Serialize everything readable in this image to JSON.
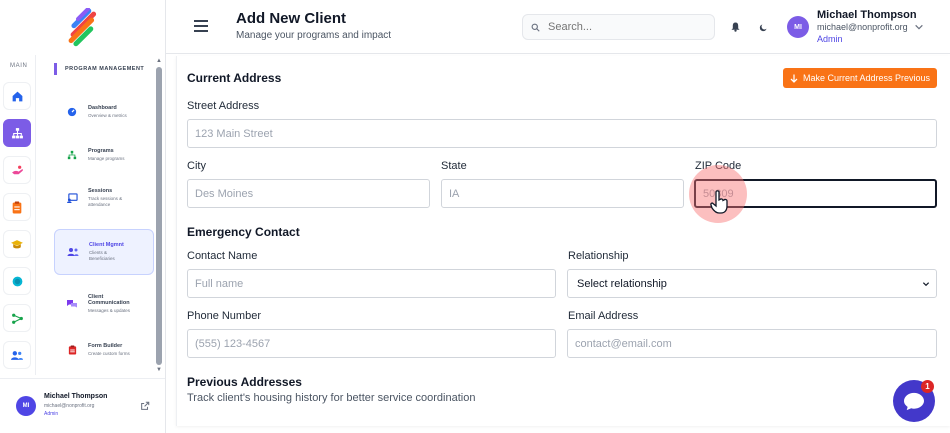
{
  "colors": {
    "accent": "#7c5ce6",
    "primary": "#4f46e5",
    "orange": "#f97316",
    "chat": "#4338ca",
    "badge": "#dc2626"
  },
  "rail": {
    "label": "MAIN",
    "items": [
      {
        "icon": "home-icon",
        "active": false
      },
      {
        "icon": "sitemap-icon",
        "active": true
      },
      {
        "icon": "hand-heart-icon",
        "active": false
      },
      {
        "icon": "clipboard-icon",
        "active": false
      },
      {
        "icon": "graduation-cap-icon",
        "active": false
      },
      {
        "icon": "globe-icon",
        "active": false
      },
      {
        "icon": "share-nodes-icon",
        "active": false
      },
      {
        "icon": "users-icon",
        "active": false
      }
    ]
  },
  "sidebar": {
    "section_title": "PROGRAM MANAGEMENT",
    "items": [
      {
        "title": "Dashboard",
        "sub": "Overview & metrics",
        "icon": "dashboard-icon"
      },
      {
        "title": "Programs",
        "sub": "Manage programs",
        "icon": "programs-icon"
      },
      {
        "title": "Sessions",
        "sub": "Track sessions & attendance",
        "icon": "sessions-icon"
      },
      {
        "title": "Client Mgmnt",
        "sub": "Clients & Beneficiaries",
        "icon": "clients-icon"
      },
      {
        "title": "Client Communication",
        "sub": "Messages & updates",
        "icon": "chat-icon"
      },
      {
        "title": "Form Builder",
        "sub": "Create custom forms",
        "icon": "form-icon"
      }
    ],
    "footer": {
      "initials": "MI",
      "name": "Michael Thompson",
      "email": "michael@nonprofit.org",
      "role": "Admin"
    }
  },
  "header": {
    "title": "Add New Client",
    "subtitle": "Manage your programs and impact",
    "search_placeholder": "Search...",
    "user": {
      "initials": "MI",
      "name": "Michael Thompson",
      "email": "michael@nonprofit.org",
      "role": "Admin"
    }
  },
  "form": {
    "current_address": {
      "heading": "Current Address",
      "prev_button": "Make Current Address Previous",
      "street_label": "Street Address",
      "street_placeholder": "123 Main Street",
      "city_label": "City",
      "city_placeholder": "Des Moines",
      "state_label": "State",
      "state_placeholder": "IA",
      "zip_label": "ZIP Code",
      "zip_placeholder": "50309"
    },
    "emergency": {
      "heading": "Emergency Contact",
      "name_label": "Contact Name",
      "name_placeholder": "Full name",
      "relationship_label": "Relationship",
      "relationship_value": "Select relationship",
      "phone_label": "Phone Number",
      "phone_placeholder": "(555) 123-4567",
      "email_label": "Email Address",
      "email_placeholder": "contact@email.com"
    },
    "previous": {
      "heading": "Previous Addresses",
      "description": "Track client's housing history for better service coordination"
    }
  },
  "chat": {
    "badge_count": "1"
  }
}
